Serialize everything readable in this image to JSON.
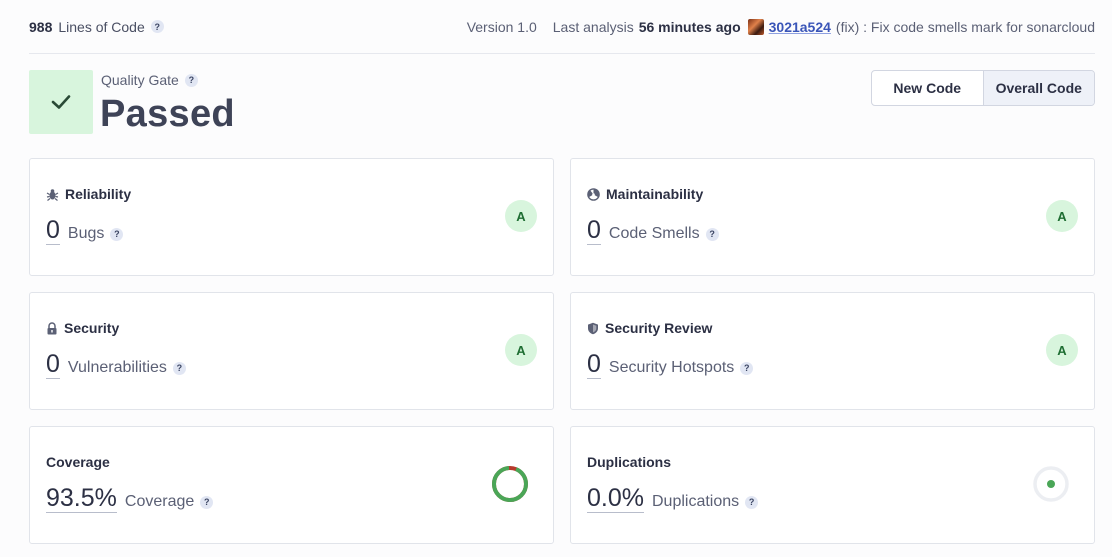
{
  "header": {
    "lines_of_code_value": "988",
    "lines_of_code_label": "Lines of Code",
    "version": "Version 1.0",
    "last_analysis_label": "Last analysis",
    "last_analysis_ago": "56 minutes ago",
    "commit_hash": "3021a524",
    "commit_message": "(fix) : Fix code smells mark for sonarcloud"
  },
  "quality_gate": {
    "label": "Quality Gate",
    "status": "Passed"
  },
  "toggle": {
    "new_code": "New Code",
    "overall_code": "Overall Code",
    "active": "overall_code"
  },
  "help_glyph": "?",
  "cards": {
    "reliability": {
      "title": "Reliability",
      "value": "0",
      "label": "Bugs",
      "rating": "A",
      "icon": "bug-icon"
    },
    "maintainability": {
      "title": "Maintainability",
      "value": "0",
      "label": "Code Smells",
      "rating": "A",
      "icon": "smell-icon"
    },
    "security": {
      "title": "Security",
      "value": "0",
      "label": "Vulnerabilities",
      "rating": "A",
      "icon": "lock-icon"
    },
    "security_review": {
      "title": "Security Review",
      "value": "0",
      "label": "Security Hotspots",
      "rating": "A",
      "icon": "shield-icon"
    },
    "coverage": {
      "title": "Coverage",
      "value": "93.5%",
      "label": "Coverage",
      "percent": 93.5,
      "icon": "coverage-donut-icon"
    },
    "duplications": {
      "title": "Duplications",
      "value": "0.0%",
      "label": "Duplications",
      "percent": 0.0,
      "icon": "duplications-icon"
    }
  },
  "colors": {
    "passed_bg": "#d8f5dd",
    "passed_check": "#1f6e33",
    "coverage_green": "#4aa657",
    "coverage_red": "#b7392c",
    "link": "#3a55b8"
  }
}
